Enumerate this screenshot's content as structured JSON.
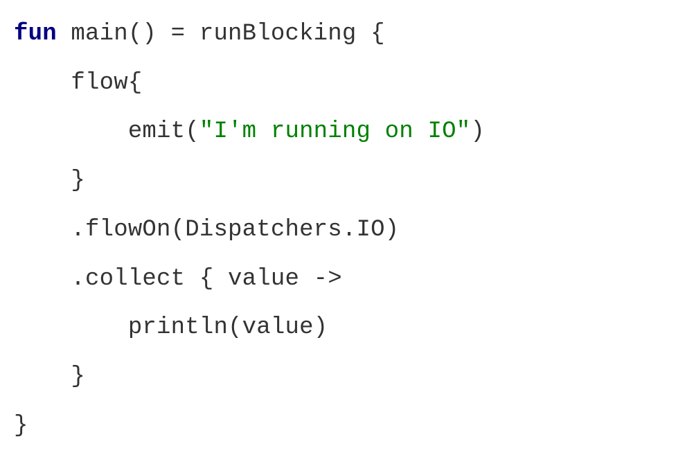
{
  "code": {
    "line1": {
      "kw_fun": "fun",
      "rest": " main() = runBlocking {"
    },
    "line2": "    flow{",
    "line3": {
      "before": "        emit(",
      "str": "\"I'm running on IO\"",
      "after": ")"
    },
    "line4": "    }",
    "line5": "    .flowOn(Dispatchers.IO)",
    "line6": "    .collect { value ->",
    "line7": "        println(value)",
    "line8": "    }",
    "line9": "}"
  }
}
